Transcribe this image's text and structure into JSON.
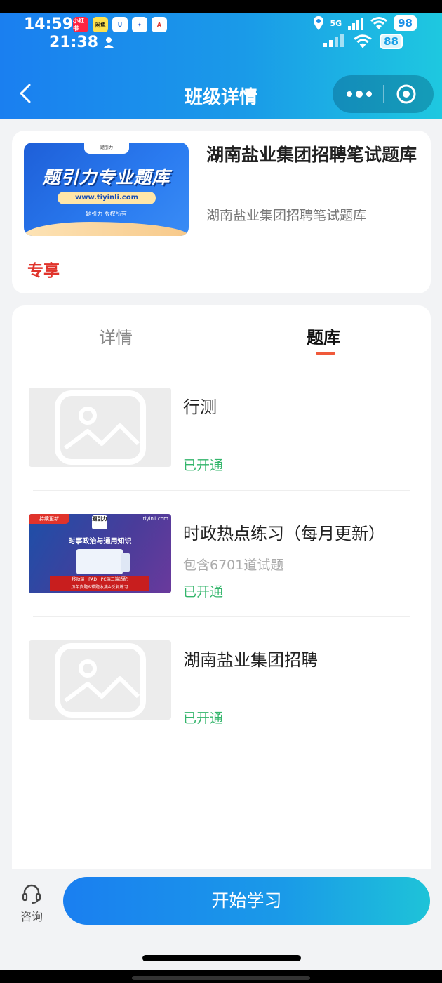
{
  "status_bar": {
    "time_primary": "14:59",
    "time_secondary": "21:38",
    "app_icons": [
      {
        "text": "小红书",
        "bg": "#ff2442",
        "fg": "#ffffff"
      },
      {
        "text": "闲鱼",
        "bg": "#ffe14d",
        "fg": "#111111"
      },
      {
        "text": "U",
        "bg": "#ffffff",
        "fg": "#1a6fe0"
      },
      {
        "text": "✦",
        "bg": "#ffffff",
        "fg": "#2a5bd7"
      },
      {
        "text": "A",
        "bg": "#ffffff",
        "fg": "#e0332b"
      }
    ],
    "network_label": "5G",
    "battery_1": "98",
    "battery_2": "88"
  },
  "header": {
    "title": "班级详情"
  },
  "course": {
    "cover": {
      "tab_text": "题引力",
      "title": "题引力专业题库",
      "url": "www.tiyinli.com",
      "copyright": "题引力 版权所有"
    },
    "name": "湖南盐业集团招聘笔试题库",
    "subtitle": "湖南盐业集团招聘笔试题库",
    "badge": "专享"
  },
  "tabs": [
    {
      "label": "详情",
      "active": false
    },
    {
      "label": "题库",
      "active": true
    }
  ],
  "items": [
    {
      "title": "行测",
      "count": "",
      "status": "已开通",
      "thumb": "placeholder"
    },
    {
      "title": "时政热点练习（每月更新）",
      "count": "包含6701道试题",
      "status": "已开通",
      "thumb": "promo"
    },
    {
      "title": "湖南盐业集团招聘",
      "count": "",
      "status": "已开通",
      "thumb": "placeholder"
    }
  ],
  "promo_thumb": {
    "badge": "持续更新",
    "logo": "题引力",
    "site": "tiyinli.com",
    "headline": "时事政治与通用知识",
    "bar_line1": "移动端 · PAD · PC端三端适配",
    "bar_line2": "历年真题&错题收集&反复练习"
  },
  "bottom": {
    "consult_label": "咨询",
    "start_button": "开始学习"
  },
  "colors": {
    "accent_blue": "#1a8fe8",
    "active_underline": "#f0593a",
    "status_green": "#33b56b",
    "badge_red": "#e0332b"
  }
}
